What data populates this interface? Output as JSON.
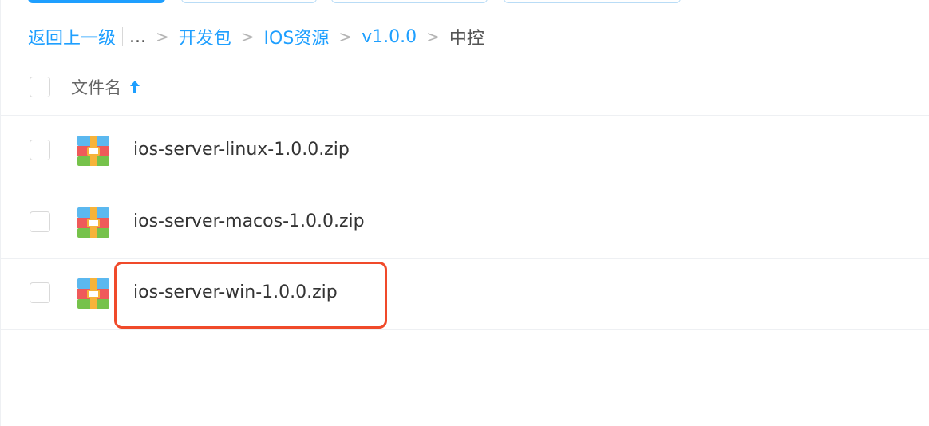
{
  "breadcrumb": {
    "back_label": "返回上一级",
    "ellipsis": "...",
    "separator": ">",
    "items": [
      {
        "label": "开发包"
      },
      {
        "label": "IOS资源"
      },
      {
        "label": "v1.0.0"
      }
    ],
    "current": "中控"
  },
  "table": {
    "column_header": "文件名",
    "sort_direction": "ascending",
    "files": [
      {
        "name": "ios-server-linux-1.0.0.zip",
        "icon": "zip-archive-icon"
      },
      {
        "name": "ios-server-macos-1.0.0.zip",
        "icon": "zip-archive-icon"
      },
      {
        "name": "ios-server-win-1.0.0.zip",
        "icon": "zip-archive-icon",
        "highlighted": true
      }
    ]
  },
  "colors": {
    "link": "#1e9fff",
    "highlight": "#f04a2a"
  }
}
